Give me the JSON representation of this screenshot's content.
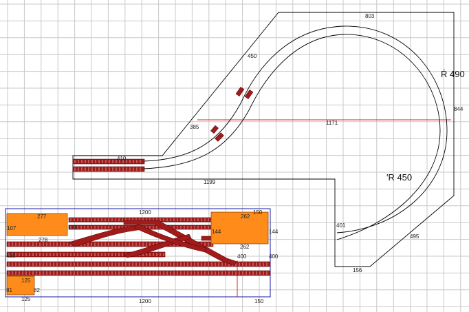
{
  "colors": {
    "grid": "#c8c8c8",
    "outline": "#000000",
    "track": "#a31a1a",
    "tie": "#ffffff",
    "orange_panel": "#ff8c1a",
    "blue_frame": "#1a1aa8",
    "measure_line": "#e02020"
  },
  "loop": {
    "dims": {
      "top": "803",
      "diag_upper": "450",
      "radius_outer": "Ŕ 490",
      "right": "844",
      "left_diag": "385",
      "center": "1171",
      "inner_top": "410",
      "bottom": "1199",
      "radius_inner": "′R 450",
      "entry": "401",
      "lower_right": "495",
      "foot": "156"
    }
  },
  "yard": {
    "dims": {
      "top": "1200",
      "top_right": "150",
      "bottom": "1200",
      "bottom_right": "150",
      "left_panel_w": "277",
      "left_panel_h": "107",
      "left_inner": "186",
      "mid_left": "278",
      "left_low": "400",
      "right_panel_w": "262",
      "right_panel_h": "144",
      "right_edge": "144",
      "right_inner": "262",
      "right_low": "400",
      "right_low2": "400",
      "small_w": "125",
      "small_h": "81",
      "small_side": "82",
      "small_bottom": "125"
    }
  }
}
